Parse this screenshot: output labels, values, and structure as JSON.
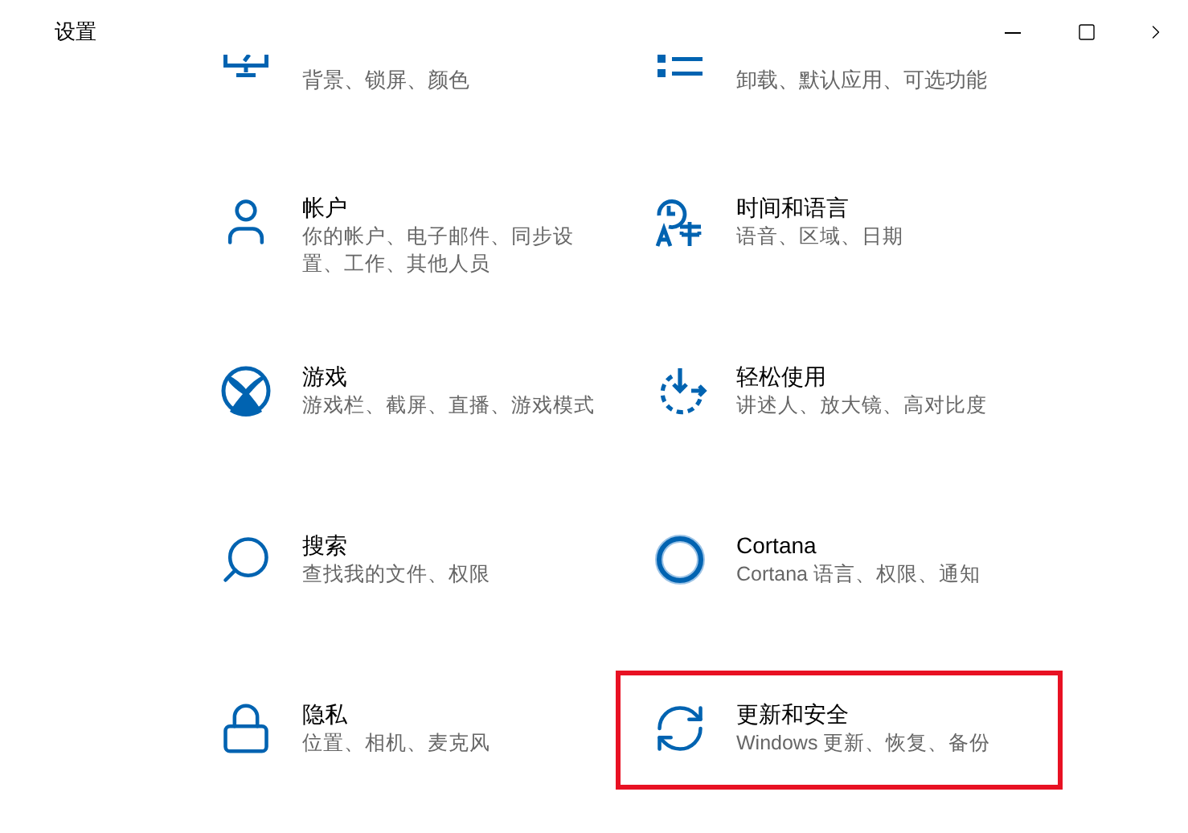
{
  "window": {
    "title": "设置"
  },
  "partial_row": [
    {
      "kind": "personalization",
      "description": "背景、锁屏、颜色"
    },
    {
      "kind": "apps",
      "description": "卸载、默认应用、可选功能"
    }
  ],
  "items": [
    {
      "kind": "accounts",
      "title": "帐户",
      "description": "你的帐户、电子邮件、同步设置、工作、其他人员",
      "highlighted": false
    },
    {
      "kind": "time-language",
      "title": "时间和语言",
      "description": "语音、区域、日期",
      "highlighted": false
    },
    {
      "kind": "gaming",
      "title": "游戏",
      "description": "游戏栏、截屏、直播、游戏模式",
      "highlighted": false
    },
    {
      "kind": "ease-of-access",
      "title": "轻松使用",
      "description": "讲述人、放大镜、高对比度",
      "highlighted": false
    },
    {
      "kind": "search",
      "title": "搜索",
      "description": "查找我的文件、权限",
      "highlighted": false
    },
    {
      "kind": "cortana",
      "title": "Cortana",
      "description": "Cortana 语言、权限、通知",
      "highlighted": false
    },
    {
      "kind": "privacy",
      "title": "隐私",
      "description": "位置、相机、麦克风",
      "highlighted": false
    },
    {
      "kind": "update",
      "title": "更新和安全",
      "description": "Windows 更新、恢复、备份",
      "highlighted": true
    }
  ]
}
